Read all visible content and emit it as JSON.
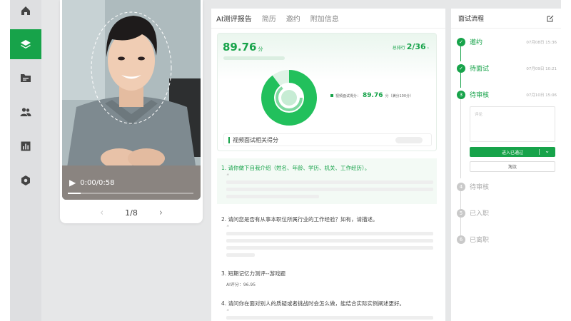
{
  "sidebar": {
    "items": [
      {
        "icon": "home-icon"
      },
      {
        "icon": "layers-icon",
        "active": true
      },
      {
        "icon": "folder-icon"
      },
      {
        "icon": "users-icon"
      },
      {
        "icon": "chart-icon"
      },
      {
        "icon": "settings-hex-icon"
      }
    ]
  },
  "video": {
    "time": "0:00/0:58",
    "progress": 0.1,
    "pager": "1/8",
    "prev": "‹",
    "next": "›"
  },
  "report": {
    "tabs": [
      "AI测评报告",
      "简历",
      "邀约",
      "附加信息"
    ],
    "score": "89.76",
    "score_unit": "分",
    "rank_label": "总排行",
    "rank_value": "2/36",
    "legend_label": "视频面试得分：",
    "legend_value": "89.76",
    "legend_suffix": "分（满分100分）",
    "video_score_label": "视频面试相关得分",
    "questions": [
      {
        "title": "1. 请你做下自我介绍（姓名、年龄、学历、机关、工作经历）。",
        "quote": "“"
      },
      {
        "title": "2. 请问您是否有从事本职位所属行业的工作经验？如有，请描述。",
        "quote": "“"
      },
      {
        "title": "3. 短期记忆力测评--游戏题",
        "ai_score": "AI评分：96.95"
      },
      {
        "title": "4. 请问你在面对别人的质疑或者挑战时会怎么做，能结合实际实例阐述更好。",
        "quote": "“"
      }
    ]
  },
  "process": {
    "title": "面试流程",
    "steps": [
      {
        "label": "邀约",
        "date": "07月08日 15:36",
        "state": "done"
      },
      {
        "label": "待面试",
        "date": "07月09日 10:21",
        "state": "done"
      },
      {
        "num": "3",
        "label": "待审核",
        "date": "07月10日 15:06",
        "state": "current"
      },
      {
        "num": "4",
        "label": "待审核",
        "state": "pending"
      },
      {
        "num": "5",
        "label": "已入职",
        "state": "pending"
      },
      {
        "num": "6",
        "label": "已离职",
        "state": "pending"
      }
    ],
    "comment_placeholder": "评论",
    "pass_label": "进入已通过",
    "next_label": "淘汰"
  },
  "colors": {
    "accent": "#17a34a"
  }
}
